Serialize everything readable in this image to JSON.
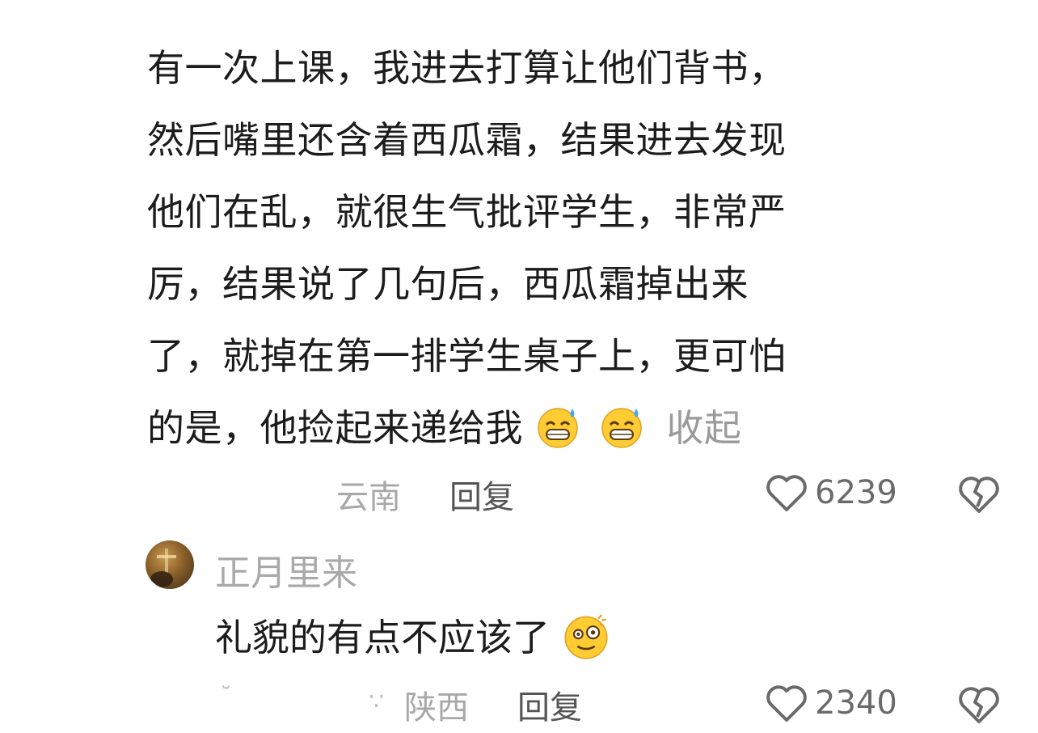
{
  "comment": {
    "lines": [
      "有一次上课，我进去打算让他们背书，",
      "然后嘴里还含着西瓜霜，结果进去发现",
      "他们在乱，就很生气批评学生，非常严",
      "厉，结果说了几句后，西瓜霜掉出来",
      "了，就掉在第一排学生桌子上，更可怕",
      "的是，他捡起来递给我"
    ],
    "emoji_icon": "sweat-grin-emoji-icon",
    "collapse_label": "收起",
    "location": "云南",
    "reply_label": "回复",
    "like_count": "6239"
  },
  "reply": {
    "username": "正月里来",
    "text": "礼貌的有点不应该了",
    "emoji_icon": "dizzy-face-emoji-icon",
    "location": "陕西",
    "reply_label": "回复",
    "like_count": "2340"
  },
  "colors": {
    "text": "#1c1c1c",
    "muted": "#a8a8a8",
    "reply_action": "#555555"
  }
}
